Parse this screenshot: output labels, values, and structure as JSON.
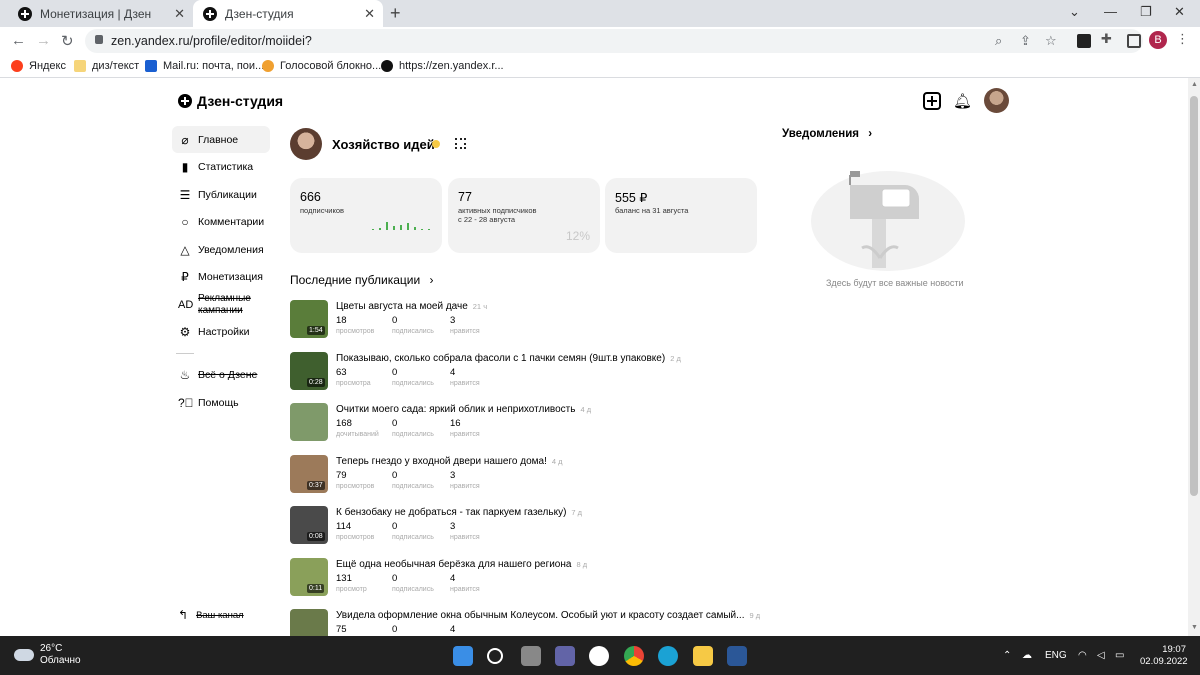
{
  "browser": {
    "tabs": [
      {
        "title": "Монетизация | Дзен",
        "active": false
      },
      {
        "title": "Дзен-студия",
        "active": true
      }
    ],
    "url": "zen.yandex.ru/profile/editor/moiidei?",
    "profile_initial": "B",
    "bookmarks": [
      {
        "label": "Яндекс",
        "icon": "yandex-icon"
      },
      {
        "label": "диз/текст",
        "icon": "folder-icon"
      },
      {
        "label": "Mail.ru: почта, пои...",
        "icon": "mailru-icon"
      },
      {
        "label": "Голосовой блокно...",
        "icon": "voice-icon"
      },
      {
        "label": "https://zen.yandex.r...",
        "icon": "zen-icon"
      }
    ]
  },
  "header": {
    "logo_text": "Дзен-студия"
  },
  "sidebar": {
    "items": [
      {
        "label": "Главное",
        "icon": "home-icon",
        "active": true,
        "strike": false
      },
      {
        "label": "Статистика",
        "icon": "stats-icon",
        "active": false,
        "strike": false
      },
      {
        "label": "Публикации",
        "icon": "publications-icon",
        "active": false,
        "strike": false
      },
      {
        "label": "Комментарии",
        "icon": "comments-icon",
        "active": false,
        "strike": false
      },
      {
        "label": "Уведомления",
        "icon": "bell-icon",
        "active": false,
        "strike": false
      },
      {
        "label": "Монетизация",
        "icon": "ruble-icon",
        "active": false,
        "strike": false
      },
      {
        "label": "Рекламные кампании",
        "icon": "ad-icon",
        "active": false,
        "strike": true
      },
      {
        "label": "Настройки",
        "icon": "gear-icon",
        "active": false,
        "strike": false
      }
    ],
    "secondary": [
      {
        "label": "Всё о Дзене",
        "icon": "flame-icon",
        "strike": true
      },
      {
        "label": "Помощь",
        "icon": "help-icon",
        "strike": false
      }
    ],
    "channel_link": "Ваш канал"
  },
  "channel": {
    "name": "Хозяйство идей"
  },
  "stats": {
    "subscribers": {
      "value": "666",
      "label": "подписчиков"
    },
    "active": {
      "value": "77",
      "label1": "активных подписчиков",
      "label2": "с 22 - 28 августа",
      "percent": "12%"
    },
    "balance": {
      "value": "555 ₽",
      "label": "баланс на 31 августа"
    }
  },
  "latest": {
    "title": "Последние публикации",
    "items": [
      {
        "title": "Цветы августа на моей даче",
        "age": "21 ч",
        "duration": "1:54",
        "v1": "18",
        "l1": "просмотров",
        "v2": "0",
        "l2": "подписались",
        "v3": "3",
        "l3": "нравится",
        "color": "#5a7d3a"
      },
      {
        "title": "Показываю, сколько собрала фасоли с 1 пачки семян (9шт.в упаковке)",
        "age": "2 д",
        "duration": "0:28",
        "v1": "63",
        "l1": "просмотра",
        "v2": "0",
        "l2": "подписались",
        "v3": "4",
        "l3": "нравится",
        "color": "#3f5f2e"
      },
      {
        "title": "Очитки моего сада: яркий облик и неприхотливость",
        "age": "4 д",
        "duration": "",
        "v1": "168",
        "l1": "дочитываний",
        "v2": "0",
        "l2": "подписались",
        "v3": "16",
        "l3": "нравится",
        "color": "#7f9a6a"
      },
      {
        "title": "Теперь гнездо у входной двери нашего дома!",
        "age": "4 д",
        "duration": "0:37",
        "v1": "79",
        "l1": "просмотров",
        "v2": "0",
        "l2": "подписались",
        "v3": "3",
        "l3": "нравится",
        "color": "#9c7a5a"
      },
      {
        "title": "К бензобаку не добраться - так паркуем газельку)",
        "age": "7 д",
        "duration": "0:08",
        "v1": "114",
        "l1": "просмотров",
        "v2": "0",
        "l2": "подписались",
        "v3": "3",
        "l3": "нравится",
        "color": "#4a4a4a"
      },
      {
        "title": "Ещё одна необычная берёзка для нашего региона",
        "age": "8 д",
        "duration": "0:11",
        "v1": "131",
        "l1": "просмотр",
        "v2": "0",
        "l2": "подписались",
        "v3": "4",
        "l3": "нравится",
        "color": "#8aa05a"
      },
      {
        "title": "Увидела оформление окна обычным Колеусом. Особый уют и красоту создает самый...",
        "age": "9 д",
        "duration": "",
        "v1": "75",
        "l1": "",
        "v2": "0",
        "l2": "",
        "v3": "4",
        "l3": "",
        "color": "#6a7a4a"
      }
    ]
  },
  "notifications": {
    "title": "Уведомления",
    "empty_text": "Здесь будут все важные новости"
  },
  "taskbar": {
    "temp": "26°C",
    "weather": "Облачно",
    "lang": "ENG",
    "time": "19:07",
    "date": "02.09.2022"
  }
}
